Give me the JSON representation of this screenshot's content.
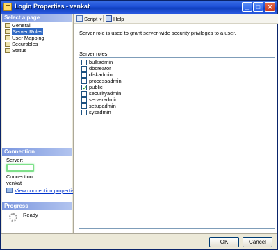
{
  "window": {
    "title": "Login Properties - venkat"
  },
  "titlebar_buttons": {
    "minimize": "_",
    "maximize": "□",
    "close": "✕"
  },
  "left": {
    "select_page_header": "Select a page",
    "pages": [
      {
        "label": "General",
        "selected": false
      },
      {
        "label": "Server Roles",
        "selected": true
      },
      {
        "label": "User Mapping",
        "selected": false
      },
      {
        "label": "Securables",
        "selected": false
      },
      {
        "label": "Status",
        "selected": false
      }
    ],
    "connection_header": "Connection",
    "server_label": "Server:",
    "connection_label": "Connection:",
    "connection_value": "venkat",
    "view_link": "View connection properties",
    "progress_header": "Progress",
    "progress_status": "Ready"
  },
  "toolbar": {
    "script_label": "Script",
    "help_label": "Help"
  },
  "main": {
    "description": "Server role is used to grant server-wide security privileges to a user.",
    "roles_label": "Server roles:",
    "roles": [
      {
        "name": "bulkadmin",
        "checked": false
      },
      {
        "name": "dbcreator",
        "checked": false
      },
      {
        "name": "diskadmin",
        "checked": false
      },
      {
        "name": "processadmin",
        "checked": false
      },
      {
        "name": "public",
        "checked": true
      },
      {
        "name": "securityadmin",
        "checked": false
      },
      {
        "name": "serveradmin",
        "checked": false
      },
      {
        "name": "setupadmin",
        "checked": false
      },
      {
        "name": "sysadmin",
        "checked": false
      }
    ]
  },
  "buttons": {
    "ok": "OK",
    "cancel": "Cancel"
  }
}
